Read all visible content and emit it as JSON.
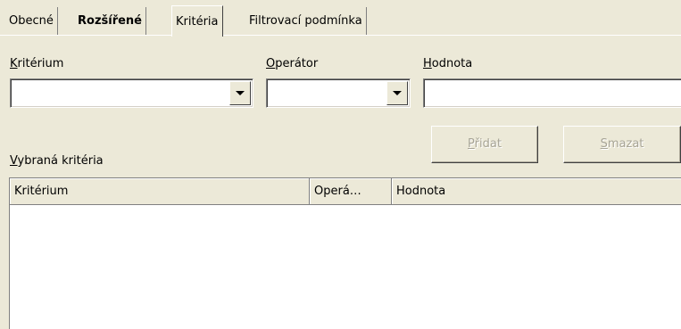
{
  "tabs": [
    {
      "label": "Obecné",
      "active": false,
      "bold": false
    },
    {
      "label": "Rozšířené",
      "active": false,
      "bold": true
    },
    {
      "label": "Kritéria",
      "active": true,
      "bold": false
    },
    {
      "label": "Filtrovací podmínka",
      "active": false,
      "bold": false
    }
  ],
  "fields": {
    "criterion": {
      "label_accel": "K",
      "label_rest": "ritérium",
      "value": ""
    },
    "operator": {
      "label_accel": "O",
      "label_rest": "perátor",
      "value": ""
    },
    "value": {
      "label_accel": "H",
      "label_rest": "odnota",
      "value": ""
    }
  },
  "buttons": {
    "add": {
      "accel": "P",
      "rest": "řidat",
      "enabled": false
    },
    "delete": {
      "accel": "S",
      "rest": "mazat",
      "enabled": false
    }
  },
  "selected": {
    "label_accel": "V",
    "label_rest": "ybraná kritéria"
  },
  "list": {
    "columns": [
      "Kritérium",
      "Operá…",
      "Hodnota"
    ],
    "rows": []
  }
}
